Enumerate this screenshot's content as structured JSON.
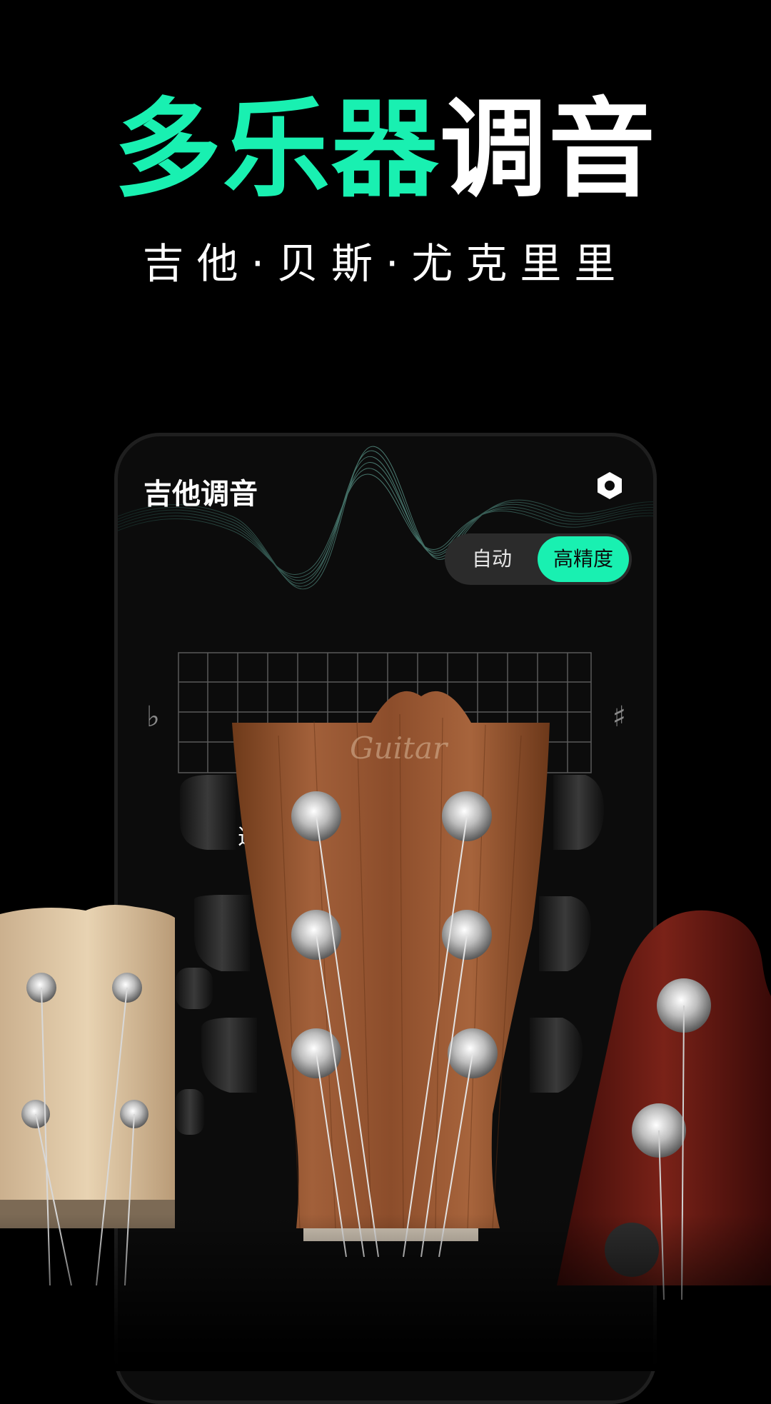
{
  "headline": {
    "part_green": "多乐器",
    "part_white": "调音"
  },
  "subheadline": "吉他·贝斯·尤克里里",
  "app": {
    "title": "吉他调音",
    "settings_icon": "settings-hexagon-icon",
    "modes": [
      "自动",
      "高精度"
    ],
    "active_mode": "高精度",
    "flat_symbol": "♭",
    "sharp_symbol": "♯",
    "partial_text": "选"
  },
  "headstock": {
    "brand_text": "Guitar"
  },
  "colors": {
    "accent": "#19f0b1",
    "background": "#000000"
  }
}
